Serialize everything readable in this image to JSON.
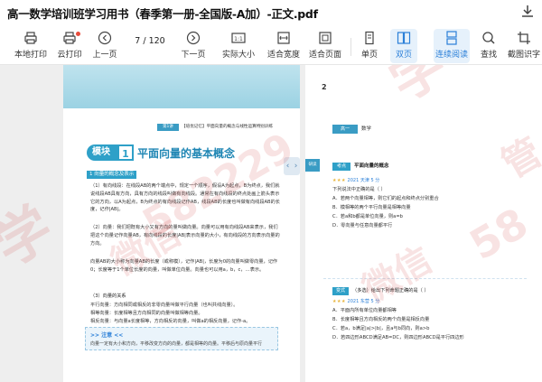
{
  "window": {
    "title": "高一数学培训班学习用书（春季第一册-全国版-A加）-正文.pdf"
  },
  "toolbar": {
    "local_print": "本地打印",
    "cloud_print": "云打印",
    "prev_page": "上一页",
    "page_current": "7",
    "page_total": "/ 120",
    "next_page": "下一页",
    "actual_size": "实际大小",
    "fit_width": "适合宽度",
    "fit_page": "适合页面",
    "single_page": "单页",
    "double_page": "双页",
    "continuous": "连续阅读",
    "find": "查找",
    "screenshot": "截图识字"
  },
  "left_page": {
    "header_tag": "第1讲",
    "header_text": "【培优记忆】平面向量的概念与线性运算特别训练",
    "module_label": "模块",
    "module_num": "1",
    "module_title": "平面向量的基本概念",
    "section1": "1 向量的概念及表示",
    "para1": "（1）有向线段：在线段AB的两个端点中，规定一个顺序，假设A为起点，B为终点，我们就说线段AB具有方向，具有方向的线段叫做有向线段。通常在有向线段的终点处画上箭头表示它的方向，以A为起点，B为终点的有向线段记作AB，线段AB的长度也叫做有向线段AB的长度，记作|AB|。",
    "para2": "（2）向量：我们把既有大小又有方向的量叫做向量。向量可以用有向线段AB来表示，我们把这个向量记作向量AB，有向线段的长度|AB|表示向量的大小，有向线段的方向表示向量的方向。",
    "para3": "向量AB的大小称为向量AB的长度（或称模），记作|AB|，长度为0的向量叫做零向量，记作0；长度等于1个单位长度的向量，叫做单位向量。向量也可以用a，b，c，…表示。",
    "section2": "（3）向量的关系",
    "para4": "平行向量：方向相同或相反的非零向量叫做平行向量（也叫共线向量）。",
    "para5": "相等向量：长度相等且方向相同的向量叫做相等向量。",
    "para6": "相反向量：与向量a长度相等，方向相反的向量，叫做a的相反向量，记作-a。",
    "note_head": ">> 注意 <<",
    "note_text": "向量一定有大小和方向，平移改变方向的向量，都是相等的向量。平移后与原向量平行"
  },
  "right_page": {
    "page_num": "2",
    "header_tag": "高一",
    "header_text": "数学",
    "side_tab": "研读",
    "kp_tag": "考点",
    "kp_text": "平面向量的概念",
    "q_meta": "★★★ 2021 天津 5 分",
    "q_stars": "★★★",
    "q_year": "2021 天津 5 分",
    "q_stem": "下列说法中正确的是（ ）",
    "q_a": "A．若两个向量相等，则它们的起点和终点分别重合",
    "q_b": "B．模相等的两个平行向量是相等向量",
    "q_c": "C．若a和b都是单位向量，则a=b",
    "q_d": "D．零向量与任意向量都平行",
    "ex_tag": "变式",
    "ex_text": "（多选）给出下列命题正确的是（ ）",
    "e_stars": "★★★",
    "e_year": "2021 东营 5 分",
    "e_a": "A．平面内所有单位向量都相等",
    "e_b": "B．长度相等且方向相反的两个向量是相反向量",
    "e_c": "C．若a，b满足|a|>|b|，且a与b同向，则a>b",
    "e_d": "D．若四边形ABCD满足AB=DC，则四边形ABCD是平行四边形"
  },
  "watermark": {
    "a": "学",
    "b": "微信",
    "c": "582229",
    "d": "学",
    "e": "微信",
    "f": "58",
    "g": "管"
  }
}
